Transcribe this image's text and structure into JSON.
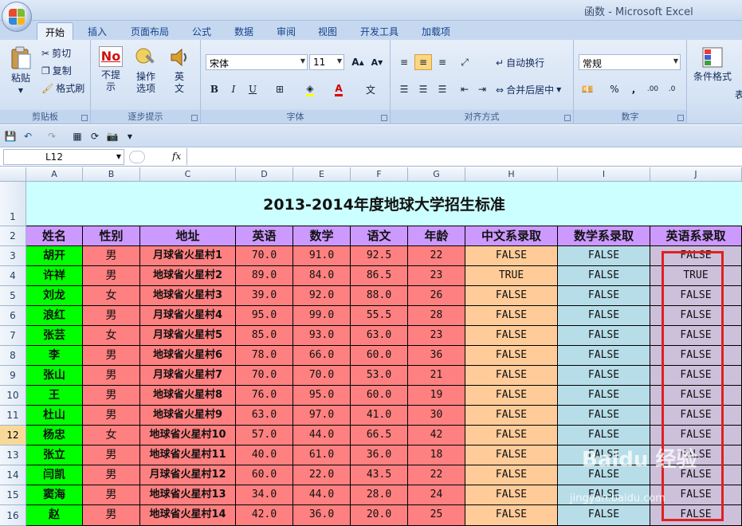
{
  "window": {
    "title": "函数 - Microsoft Excel"
  },
  "tabs": [
    "开始",
    "插入",
    "页面布局",
    "公式",
    "数据",
    "审阅",
    "视图",
    "开发工具",
    "加载项"
  ],
  "ribbon": {
    "clipboard": {
      "paste": "粘贴",
      "cut": "剪切",
      "copy": "复制",
      "format_painter": "格式刷",
      "label": "剪贴板"
    },
    "tips": {
      "no_tip": "不提示",
      "op_options": "操作选项",
      "english": "英文",
      "label": "逐步提示"
    },
    "font": {
      "name": "宋体",
      "size": "11",
      "grow": "A",
      "shrink": "A",
      "bold": "B",
      "italic": "I",
      "underline": "U",
      "label": "字体"
    },
    "align": {
      "wrap": "自动换行",
      "merge": "合并后居中",
      "label": "对齐方式"
    },
    "number": {
      "format": "常规",
      "percent": "%",
      "comma": ",",
      "label": "数字"
    },
    "styles": {
      "cond_format": "条件格式",
      "table_fmt": "表"
    }
  },
  "formula_bar": {
    "name_box": "L12",
    "fx": "fx",
    "content": ""
  },
  "columns": [
    "A",
    "B",
    "C",
    "D",
    "E",
    "F",
    "G",
    "H",
    "I",
    "J"
  ],
  "title": "2013-2014年度地球大学招生标准",
  "headers": [
    "姓名",
    "性别",
    "地址",
    "英语",
    "数学",
    "语文",
    "年龄",
    "中文系录取",
    "数学系录取",
    "英语系录取"
  ],
  "rows": [
    [
      "胡开",
      "男",
      "月球省火星村1",
      "70.0",
      "91.0",
      "92.5",
      "22",
      "FALSE",
      "FALSE",
      "FALSE"
    ],
    [
      "许祥",
      "男",
      "地球省火星村2",
      "89.0",
      "84.0",
      "86.5",
      "23",
      "TRUE",
      "FALSE",
      "TRUE"
    ],
    [
      "刘龙",
      "女",
      "地球省火星村3",
      "39.0",
      "92.0",
      "88.0",
      "26",
      "FALSE",
      "FALSE",
      "FALSE"
    ],
    [
      "浪红",
      "男",
      "月球省火星村4",
      "95.0",
      "99.0",
      "55.5",
      "28",
      "FALSE",
      "FALSE",
      "FALSE"
    ],
    [
      "张芸",
      "女",
      "月球省火星村5",
      "85.0",
      "93.0",
      "63.0",
      "23",
      "FALSE",
      "FALSE",
      "FALSE"
    ],
    [
      "李",
      "男",
      "地球省火星村6",
      "78.0",
      "66.0",
      "60.0",
      "36",
      "FALSE",
      "FALSE",
      "FALSE"
    ],
    [
      "张山",
      "男",
      "月球省火星村7",
      "70.0",
      "70.0",
      "53.0",
      "21",
      "FALSE",
      "FALSE",
      "FALSE"
    ],
    [
      "王",
      "男",
      "地球省火星村8",
      "76.0",
      "95.0",
      "60.0",
      "19",
      "FALSE",
      "FALSE",
      "FALSE"
    ],
    [
      "杜山",
      "男",
      "地球省火星村9",
      "63.0",
      "97.0",
      "41.0",
      "30",
      "FALSE",
      "FALSE",
      "FALSE"
    ],
    [
      "杨忠",
      "女",
      "地球省火星村10",
      "57.0",
      "44.0",
      "66.5",
      "42",
      "FALSE",
      "FALSE",
      "FALSE"
    ],
    [
      "张立",
      "男",
      "地球省火星村11",
      "40.0",
      "61.0",
      "36.0",
      "18",
      "FALSE",
      "FALSE",
      "FALSE"
    ],
    [
      "闫凯",
      "男",
      "月球省火星村12",
      "60.0",
      "22.0",
      "43.5",
      "22",
      "FALSE",
      "FALSE",
      "FALSE"
    ],
    [
      "窦海",
      "男",
      "地球省火星村13",
      "34.0",
      "44.0",
      "28.0",
      "24",
      "FALSE",
      "FALSE",
      "FALSE"
    ],
    [
      "赵",
      "男",
      "地球省火星村14",
      "42.0",
      "36.0",
      "20.0",
      "25",
      "FALSE",
      "FALSE",
      "FALSE"
    ]
  ],
  "row_numbers": [
    "1",
    "2",
    "3",
    "4",
    "5",
    "6",
    "7",
    "8",
    "9",
    "10",
    "11",
    "12",
    "13",
    "14",
    "15",
    "16"
  ],
  "watermark": {
    "logo": "Baidu 经验",
    "url": "jingyan.baidu.com"
  },
  "colors": {
    "name_col": "#00ff00",
    "data_red": "#ff8080",
    "header": "#cc99ff",
    "title_bg": "#ccffff",
    "col_h": "#ffcc99",
    "col_i": "#b7dde8",
    "col_j": "#ccc0da",
    "highlight": "#e02020"
  }
}
